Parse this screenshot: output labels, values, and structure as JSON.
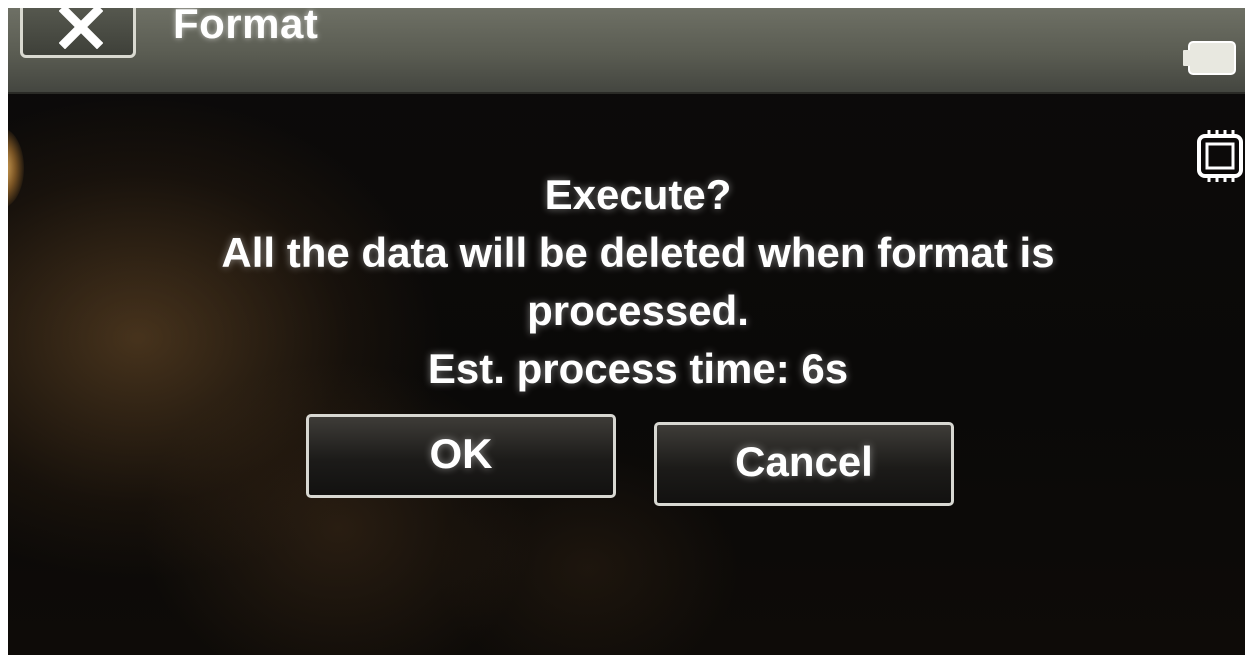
{
  "header": {
    "title": "Format",
    "close_icon": "close-icon",
    "battery_icon": "battery-icon",
    "memory_icon": "memory-card-icon"
  },
  "dialog": {
    "question": "Execute?",
    "message_line1": "All the data will be deleted when format is",
    "message_line2": "processed.",
    "estimate": "Est. process time: 6s"
  },
  "buttons": {
    "ok_label": "OK",
    "cancel_label": "Cancel"
  },
  "colors": {
    "header_bg": "#5a5c52",
    "screen_bg": "#0a0908",
    "text": "#ffffff",
    "button_border": "#d8d8d2"
  }
}
